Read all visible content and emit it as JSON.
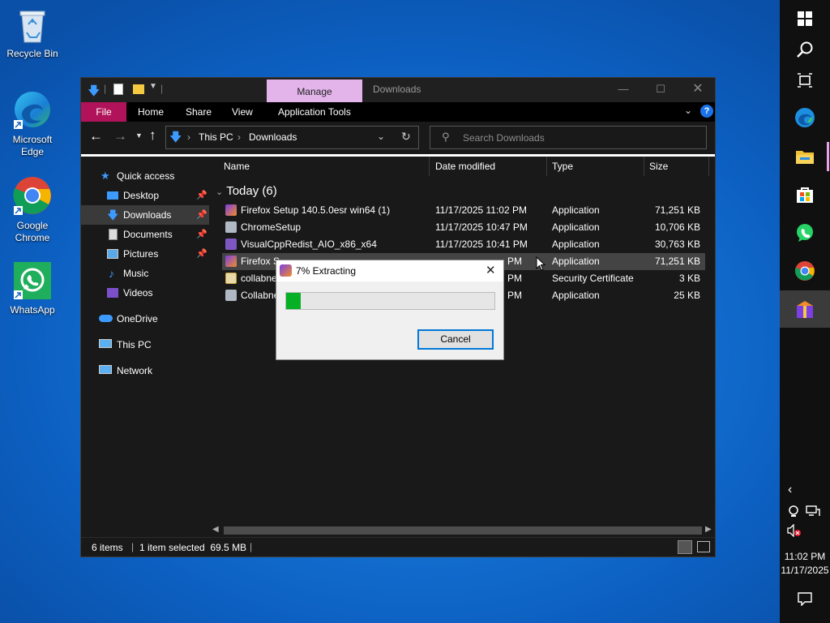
{
  "desktop": {
    "icons": [
      {
        "name": "Recycle Bin",
        "icon": "recycle-bin-icon"
      },
      {
        "name": "Microsoft Edge",
        "icon": "edge-icon"
      },
      {
        "name": "Google Chrome",
        "icon": "chrome-icon"
      },
      {
        "name": "WhatsApp",
        "icon": "whatsapp-icon"
      }
    ]
  },
  "explorer": {
    "title": "Downloads",
    "context_tab": "Manage",
    "ribbon_tabs": [
      "File",
      "Home",
      "Share",
      "View",
      "Application Tools"
    ],
    "address": {
      "segments": [
        "This PC",
        "Downloads"
      ]
    },
    "search_placeholder": "Search Downloads",
    "nav": {
      "quick_access": "Quick access",
      "items": [
        "Desktop",
        "Downloads",
        "Documents",
        "Pictures",
        "Music",
        "Videos"
      ],
      "onedrive": "OneDrive",
      "this_pc": "This PC",
      "network": "Network",
      "selected": "Downloads"
    },
    "columns": [
      "Name",
      "Date modified",
      "Type",
      "Size"
    ],
    "group": "Today (6)",
    "files": [
      {
        "name": "Firefox Setup 140.5.0esr win64 (1)",
        "date": "11/17/2025 11:02 PM",
        "type": "Application",
        "size": "71,251 KB",
        "selected": false
      },
      {
        "name": "ChromeSetup",
        "date": "11/17/2025 10:47 PM",
        "type": "Application",
        "size": "10,706 KB",
        "selected": false
      },
      {
        "name": "VisualCppRedist_AIO_x86_x64",
        "date": "11/17/2025 10:41 PM",
        "type": "Application",
        "size": "30,763 KB",
        "selected": false
      },
      {
        "name": "Firefox S",
        "date": "PM",
        "type": "Application",
        "size": "71,251 KB",
        "selected": true
      },
      {
        "name": "collabne",
        "date": "PM",
        "type": "Security Certificate",
        "size": "3 KB",
        "selected": false
      },
      {
        "name": "Collabne",
        "date": "PM",
        "type": "Application",
        "size": "25 KB",
        "selected": false
      }
    ],
    "status": {
      "items": "6 items",
      "selection": "1 item selected  69.5 MB"
    }
  },
  "dialog": {
    "title": "7% Extracting",
    "progress": 0.07,
    "cancel_label": "Cancel"
  },
  "taskbar": {
    "time": "11:02 PM",
    "date": "11/17/2025",
    "apps": [
      "windows-start-icon",
      "search-icon",
      "task-view-icon",
      "edge-icon",
      "file-explorer-icon",
      "store-icon",
      "whatsapp-icon",
      "chrome-icon",
      "firefox-installer-icon"
    ]
  },
  "colors": {
    "accent_file_tab": "#b0135a",
    "manage_tab": "#e2b4ea",
    "progress": "#06b025",
    "taskbar": "#101010"
  }
}
